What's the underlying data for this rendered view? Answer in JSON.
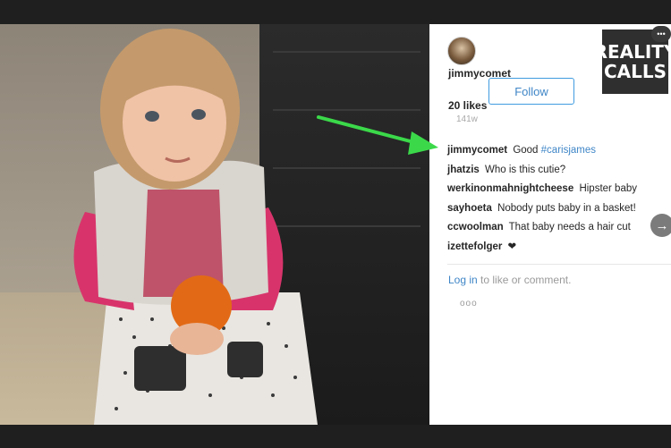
{
  "profile": {
    "username": "jimmycomet",
    "follow_label": "Follow",
    "likes": "20 likes",
    "time_ago": "141w"
  },
  "comments": [
    {
      "user": "jimmycomet",
      "text": "Good",
      "hashtag": "#carisjames"
    },
    {
      "user": "jhatzis",
      "text": "Who is this cutie?"
    },
    {
      "user": "werkinonmahnightcheese",
      "text": "Hipster baby"
    },
    {
      "user": "sayhoeta",
      "text": "Nobody puts baby in a basket!"
    },
    {
      "user": "ccwoolman",
      "text": "That baby needs a hair cut"
    },
    {
      "user": "izettefolger",
      "text": "❤"
    }
  ],
  "footer": {
    "login_link": "Log in",
    "login_rest": "to like or comment.",
    "more": "ooo"
  },
  "watermark": {
    "line1": "REALITY",
    "line2": "CALLS"
  },
  "icons": {
    "next": "chevron-right-icon",
    "more": "more-dots-icon",
    "pointer": "green-arrow-icon"
  },
  "colors": {
    "link": "#3f86c7",
    "arrow": "#3bd94a"
  }
}
